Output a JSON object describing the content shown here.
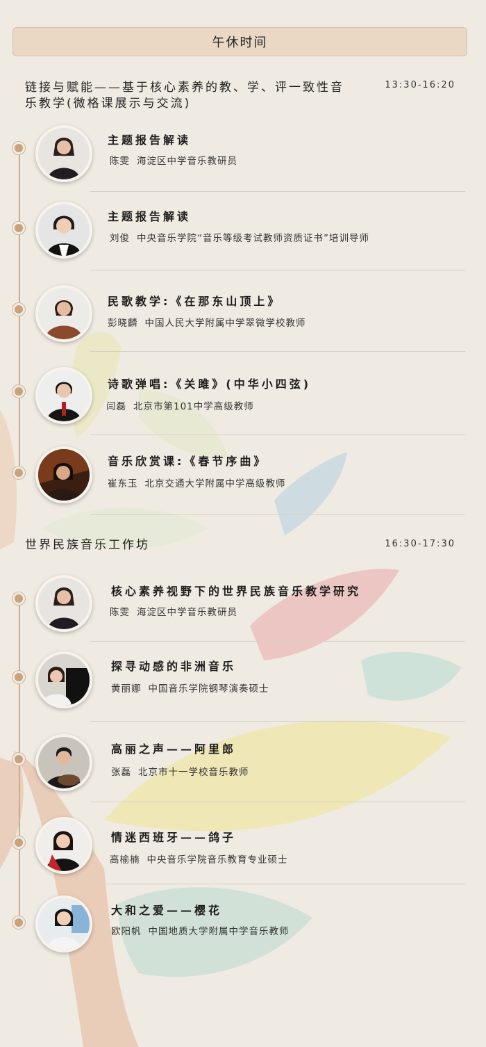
{
  "banner": {
    "label": "午休时间"
  },
  "sections": [
    {
      "title": "链接与赋能——基于核心素养的教、学、评一致性音乐教学(微格课展示与交流)",
      "time": "13:30-16:20",
      "items": [
        {
          "title": "主题报告解读",
          "name": "陈雯",
          "role": "海淀区中学音乐教研员"
        },
        {
          "title": "主题报告解读",
          "name": "刘俊",
          "role": "中央音乐学院“音乐等级考试教师资质证书”培训导师"
        },
        {
          "title": "民歌教学:《在那东山顶上》",
          "name": "彭晓麟",
          "role": "中国人民大学附属中学翠微学校教师"
        },
        {
          "title": "诗歌弹唱:《关雎》(中华小四弦)",
          "name": "闫磊",
          "role": "北京市第101中学高级教师"
        },
        {
          "title": "音乐欣赏课:《春节序曲》",
          "name": "崔东玉",
          "role": "北京交通大学附属中学高级教师"
        }
      ]
    },
    {
      "title": "世界民族音乐工作坊",
      "time": "16:30-17:30",
      "items": [
        {
          "title": "核心素养视野下的世界民族音乐教学研究",
          "name": "陈雯",
          "role": "海淀区中学音乐教研员"
        },
        {
          "title": "探寻动感的非洲音乐",
          "name": "黄丽娜",
          "role": "中国音乐学院钢琴演奏硕士"
        },
        {
          "title": "高丽之声——阿里郎",
          "name": "张磊",
          "role": "北京市十一学校音乐教师"
        },
        {
          "title": "情迷西班牙——鸽子",
          "name": "高榆楠",
          "role": "中央音乐学院音乐教育专业硕士"
        },
        {
          "title": "大和之爱——樱花",
          "name": "欧阳帆",
          "role": "中国地质大学附属中学音乐教师"
        }
      ]
    }
  ],
  "colors": {
    "background": "#efebe2",
    "banner": "#ead8c5",
    "dot": "#c9a27e",
    "line": "#c9aa8c"
  }
}
